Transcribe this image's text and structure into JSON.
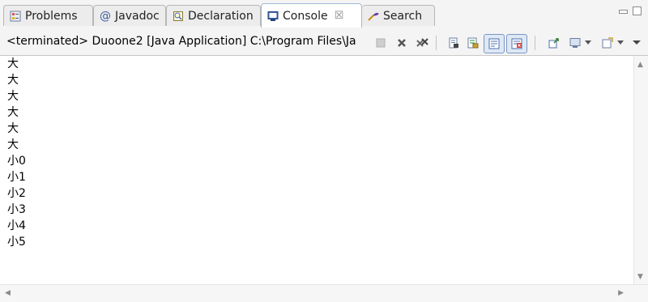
{
  "tabs": [
    {
      "label": "Problems",
      "icon": "problems-icon"
    },
    {
      "label": "Javadoc",
      "icon": "at-icon"
    },
    {
      "label": "Declaration",
      "icon": "declaration-icon"
    },
    {
      "label": "Console",
      "icon": "console-icon",
      "active": true
    },
    {
      "label": "Search",
      "icon": "search-icon"
    }
  ],
  "tab_close_glyph": "☒",
  "status": "<terminated> Duoone2 [Java Application] C:\\Program Files\\Ja",
  "toolbar_icons": [
    "terminate-icon",
    "remove-launch-icon",
    "remove-all-terminated-icon",
    "clear-console-icon",
    "scroll-lock-icon",
    "show-on-stdout-icon",
    "show-on-stderr-icon",
    "pin-console-icon",
    "display-console-icon",
    "open-console-icon"
  ],
  "console_lines": [
    "大",
    "大",
    "大",
    "大",
    "大",
    "大",
    "小0",
    "小1",
    "小2",
    "小3",
    "小4",
    "小5"
  ],
  "colors": {
    "tabbar_bg": "#f4f4f4",
    "active_tab_border": "#9fb7d9",
    "console_bg": "#ffffff"
  }
}
